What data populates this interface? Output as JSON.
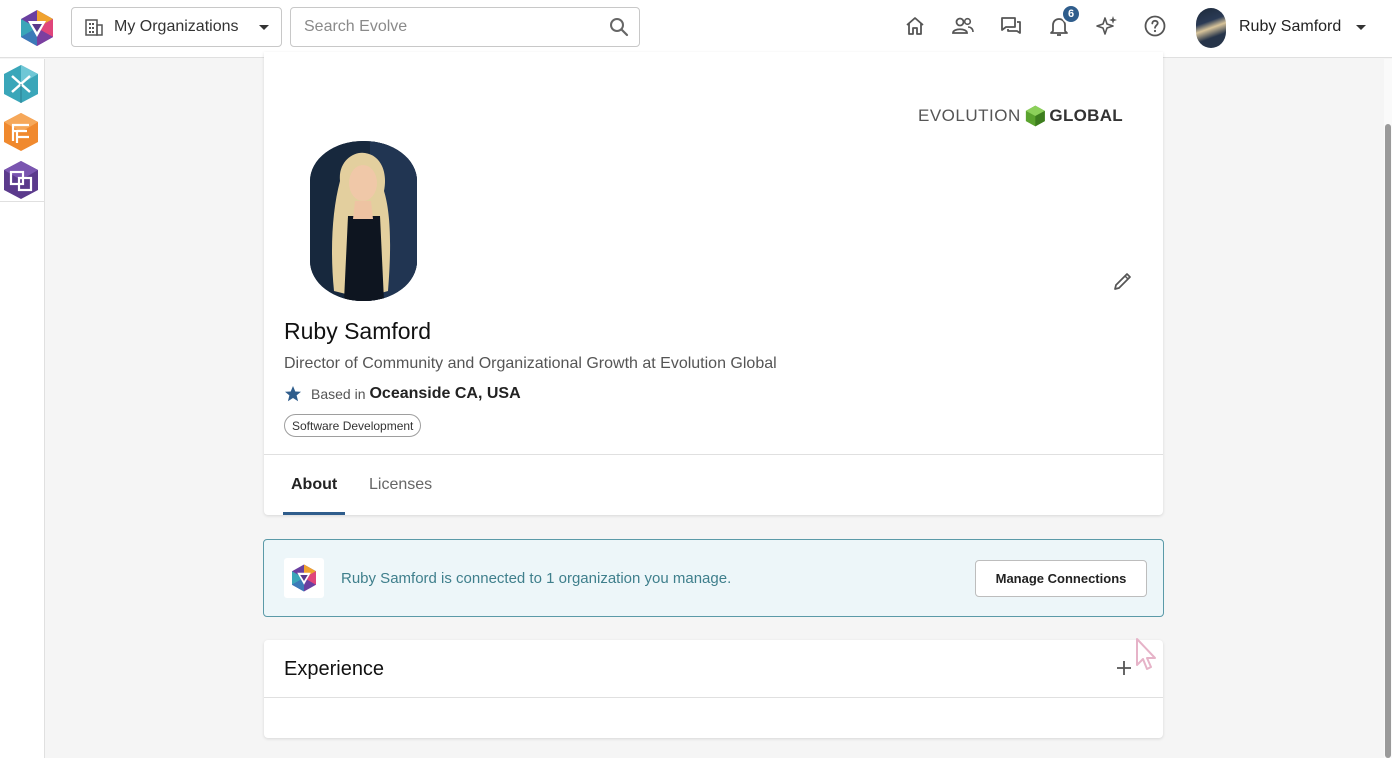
{
  "header": {
    "org_selector_label": "My Organizations",
    "search_placeholder": "Search Evolve",
    "notification_count": "6",
    "user_name": "Ruby Samford"
  },
  "sidebar": {
    "apps": [
      {
        "icon": "app-x-icon",
        "color": "#3aa6b9"
      },
      {
        "icon": "app-f-icon",
        "color": "#f0892e"
      },
      {
        "icon": "app-link-icon",
        "color": "#5b3a8c"
      }
    ]
  },
  "profile": {
    "company_logo_left": "EVOLUTION",
    "company_logo_right": "GLOBAL",
    "name": "Ruby Samford",
    "title": "Director of Community and Organizational Growth at Evolution Global",
    "location_prefix": "Based in",
    "location": "Oceanside CA, USA",
    "tag": "Software Development",
    "tabs": [
      {
        "label": "About",
        "active": true
      },
      {
        "label": "Licenses",
        "active": false
      }
    ]
  },
  "connection": {
    "message": "Ruby Samford is connected to 1 organization you manage.",
    "button_label": "Manage Connections"
  },
  "experience": {
    "title": "Experience"
  },
  "colors": {
    "accent": "#2f5d8c",
    "connection_bg": "#edf6f9",
    "connection_border": "#5b9aa8",
    "connection_text": "#3f7f8c"
  }
}
